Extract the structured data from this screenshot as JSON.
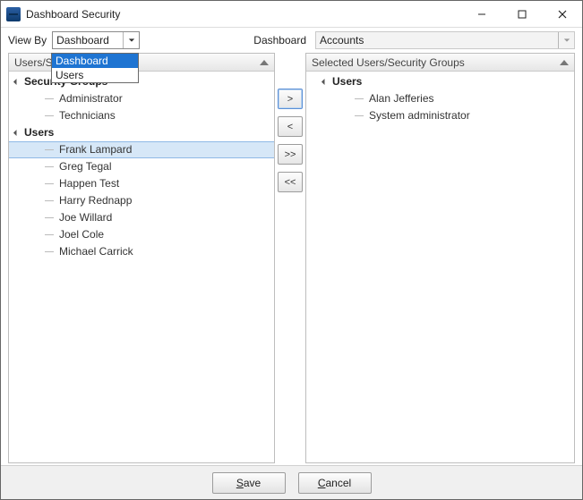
{
  "window": {
    "title": "Dashboard Security"
  },
  "toolbar": {
    "view_by_label": "View By",
    "view_by_value": "Dashboard",
    "view_by_options": [
      "Dashboard",
      "Users"
    ],
    "dashboard_label": "Dashboard",
    "dashboard_value": "Accounts"
  },
  "left_panel": {
    "header": "Users/Security Groups",
    "groups": [
      {
        "label": "Security Groups",
        "items": [
          "Administrator",
          "Technicians"
        ]
      },
      {
        "label": "Users",
        "items": [
          "Frank Lampard",
          "Greg Tegal",
          "Happen Test",
          "Harry Rednapp",
          "Joe Willard",
          "Joel Cole",
          "Michael Carrick"
        ],
        "highlighted_index": 0
      }
    ]
  },
  "right_panel": {
    "header": "Selected Users/Security Groups",
    "groups": [
      {
        "label": "Users",
        "items": [
          "Alan Jefferies",
          "System administrator"
        ]
      }
    ]
  },
  "transfer": {
    "add": ">",
    "remove": "<",
    "add_all": ">>",
    "remove_all": "<<"
  },
  "footer": {
    "save": "Save",
    "cancel": "Cancel"
  }
}
